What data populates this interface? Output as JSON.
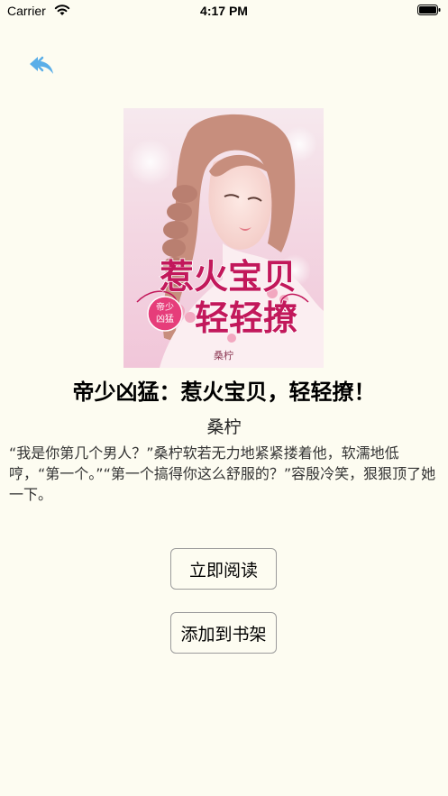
{
  "status_bar": {
    "carrier": "Carrier",
    "time": "4:17 PM",
    "icons": [
      "wifi-icon",
      "battery-icon"
    ]
  },
  "nav": {
    "back_icon": "back-arrow-icon",
    "accent_color": "#5aaee8"
  },
  "book": {
    "cover": {
      "title_art_line1": "惹火宝贝",
      "title_art_line2": "轻轻撩",
      "seal_text": "帝少凶猛",
      "author_art": "桑柠"
    },
    "title": "帝少凶猛：惹火宝贝，轻轻撩！",
    "author": "桑柠",
    "description": "“我是你第几个男人？”桑柠软若无力地紧紧搂着他，软濡地低哼，“第一个。”“第一个搞得你这么舒服的？”容殷冷笑，狠狠顶了她一下。"
  },
  "actions": {
    "read_now": "立即阅读",
    "add_to_shelf": "添加到书架"
  },
  "colors": {
    "background": "#fdfcf1",
    "button_border": "#9b9b9b",
    "cover_title": "#c2185b"
  }
}
